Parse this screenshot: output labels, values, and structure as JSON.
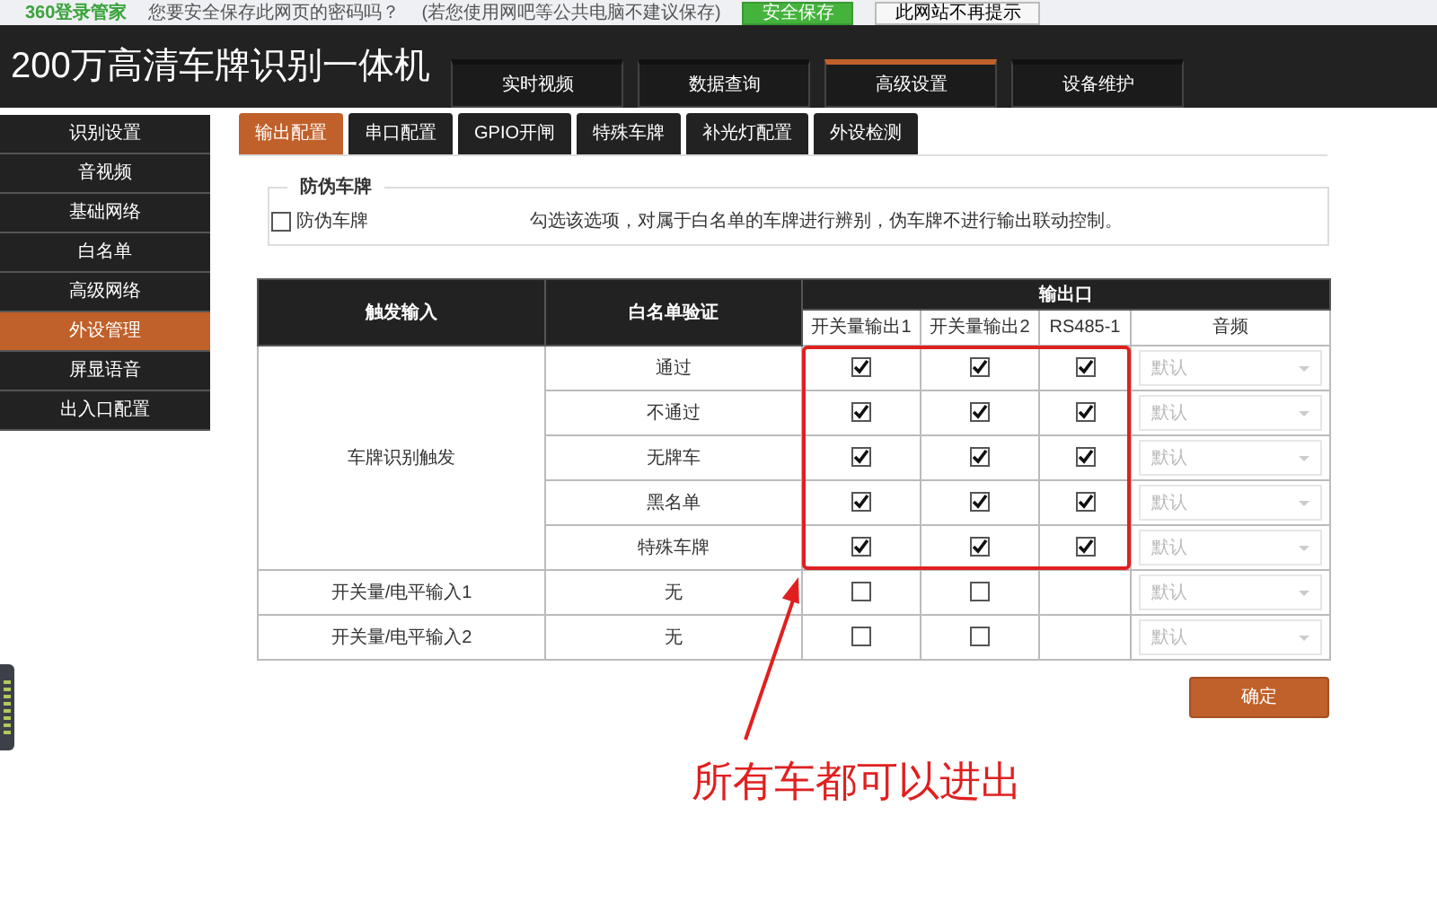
{
  "browser_prompt": {
    "brand": "360登录管家",
    "message": "您要安全保存此网页的密码吗？",
    "hint": "(若您使用网吧等公共电脑不建议保存)",
    "buttons": [
      {
        "label": "安全保存",
        "kind": "primary"
      },
      {
        "label": "此网站不再提示",
        "kind": "plain"
      }
    ]
  },
  "header": {
    "title": "200万高清车牌识别一体机",
    "tabs": [
      {
        "label": "实时视频",
        "selected": false
      },
      {
        "label": "数据查询",
        "selected": false
      },
      {
        "label": "高级设置",
        "selected": true
      },
      {
        "label": "设备维护",
        "selected": false
      }
    ]
  },
  "sidebar": {
    "items": [
      {
        "label": "识别设置",
        "selected": false
      },
      {
        "label": "音视频",
        "selected": false
      },
      {
        "label": "基础网络",
        "selected": false
      },
      {
        "label": "白名单",
        "selected": false
      },
      {
        "label": "高级网络",
        "selected": false
      },
      {
        "label": "外设管理",
        "selected": true
      },
      {
        "label": "屏显语音",
        "selected": false
      },
      {
        "label": "出入口配置",
        "selected": false
      }
    ]
  },
  "subtabs": [
    {
      "label": "输出配置",
      "selected": true
    },
    {
      "label": "串口配置",
      "selected": false
    },
    {
      "label": "GPIO开闸",
      "selected": false
    },
    {
      "label": "特殊车牌",
      "selected": false
    },
    {
      "label": "补光灯配置",
      "selected": false
    },
    {
      "label": "外设检测",
      "selected": false
    }
  ],
  "anti_fake": {
    "legend": "防伪车牌",
    "checkbox": {
      "label": "防伪车牌",
      "checked": false
    },
    "description": "勾选该选项，对属于白名单的车牌进行辨别，伪车牌不进行输出联动控制。"
  },
  "table": {
    "head": {
      "trigger": "触发输入",
      "verify": "白名单验证",
      "output": "输出口",
      "columns": [
        "开关量输出1",
        "开关量输出2",
        "RS485-1",
        "音频"
      ]
    },
    "groups": [
      {
        "trigger": "车牌识别触发",
        "rows": [
          {
            "verify": "通过",
            "outputs": [
              {
                "checked": true
              },
              {
                "checked": true
              },
              {
                "checked": true
              }
            ],
            "audio": "默认",
            "audio_disabled": true
          },
          {
            "verify": "不通过",
            "outputs": [
              {
                "checked": true
              },
              {
                "checked": true
              },
              {
                "checked": true
              }
            ],
            "audio": "默认",
            "audio_disabled": true
          },
          {
            "verify": "无牌车",
            "outputs": [
              {
                "checked": true
              },
              {
                "checked": true
              },
              {
                "checked": true
              }
            ],
            "audio": "默认",
            "audio_disabled": true
          },
          {
            "verify": "黑名单",
            "outputs": [
              {
                "checked": true
              },
              {
                "checked": true
              },
              {
                "checked": true
              }
            ],
            "audio": "默认",
            "audio_disabled": true
          },
          {
            "verify": "特殊车牌",
            "outputs": [
              {
                "checked": true
              },
              {
                "checked": true
              },
              {
                "checked": true
              }
            ],
            "audio": "默认",
            "audio_disabled": true
          }
        ]
      },
      {
        "trigger": "开关量/电平输入1",
        "rows": [
          {
            "verify": "无",
            "outputs": [
              {
                "checked": false
              },
              {
                "checked": false
              }
            ],
            "audio": "默认",
            "audio_disabled": true
          }
        ]
      },
      {
        "trigger": "开关量/电平输入2",
        "rows": [
          {
            "verify": "无",
            "outputs": [
              {
                "checked": false
              },
              {
                "checked": false
              }
            ],
            "audio": "默认",
            "audio_disabled": true
          }
        ]
      }
    ]
  },
  "confirm_button": "确定",
  "annotation": {
    "text": "所有车都可以进出"
  }
}
